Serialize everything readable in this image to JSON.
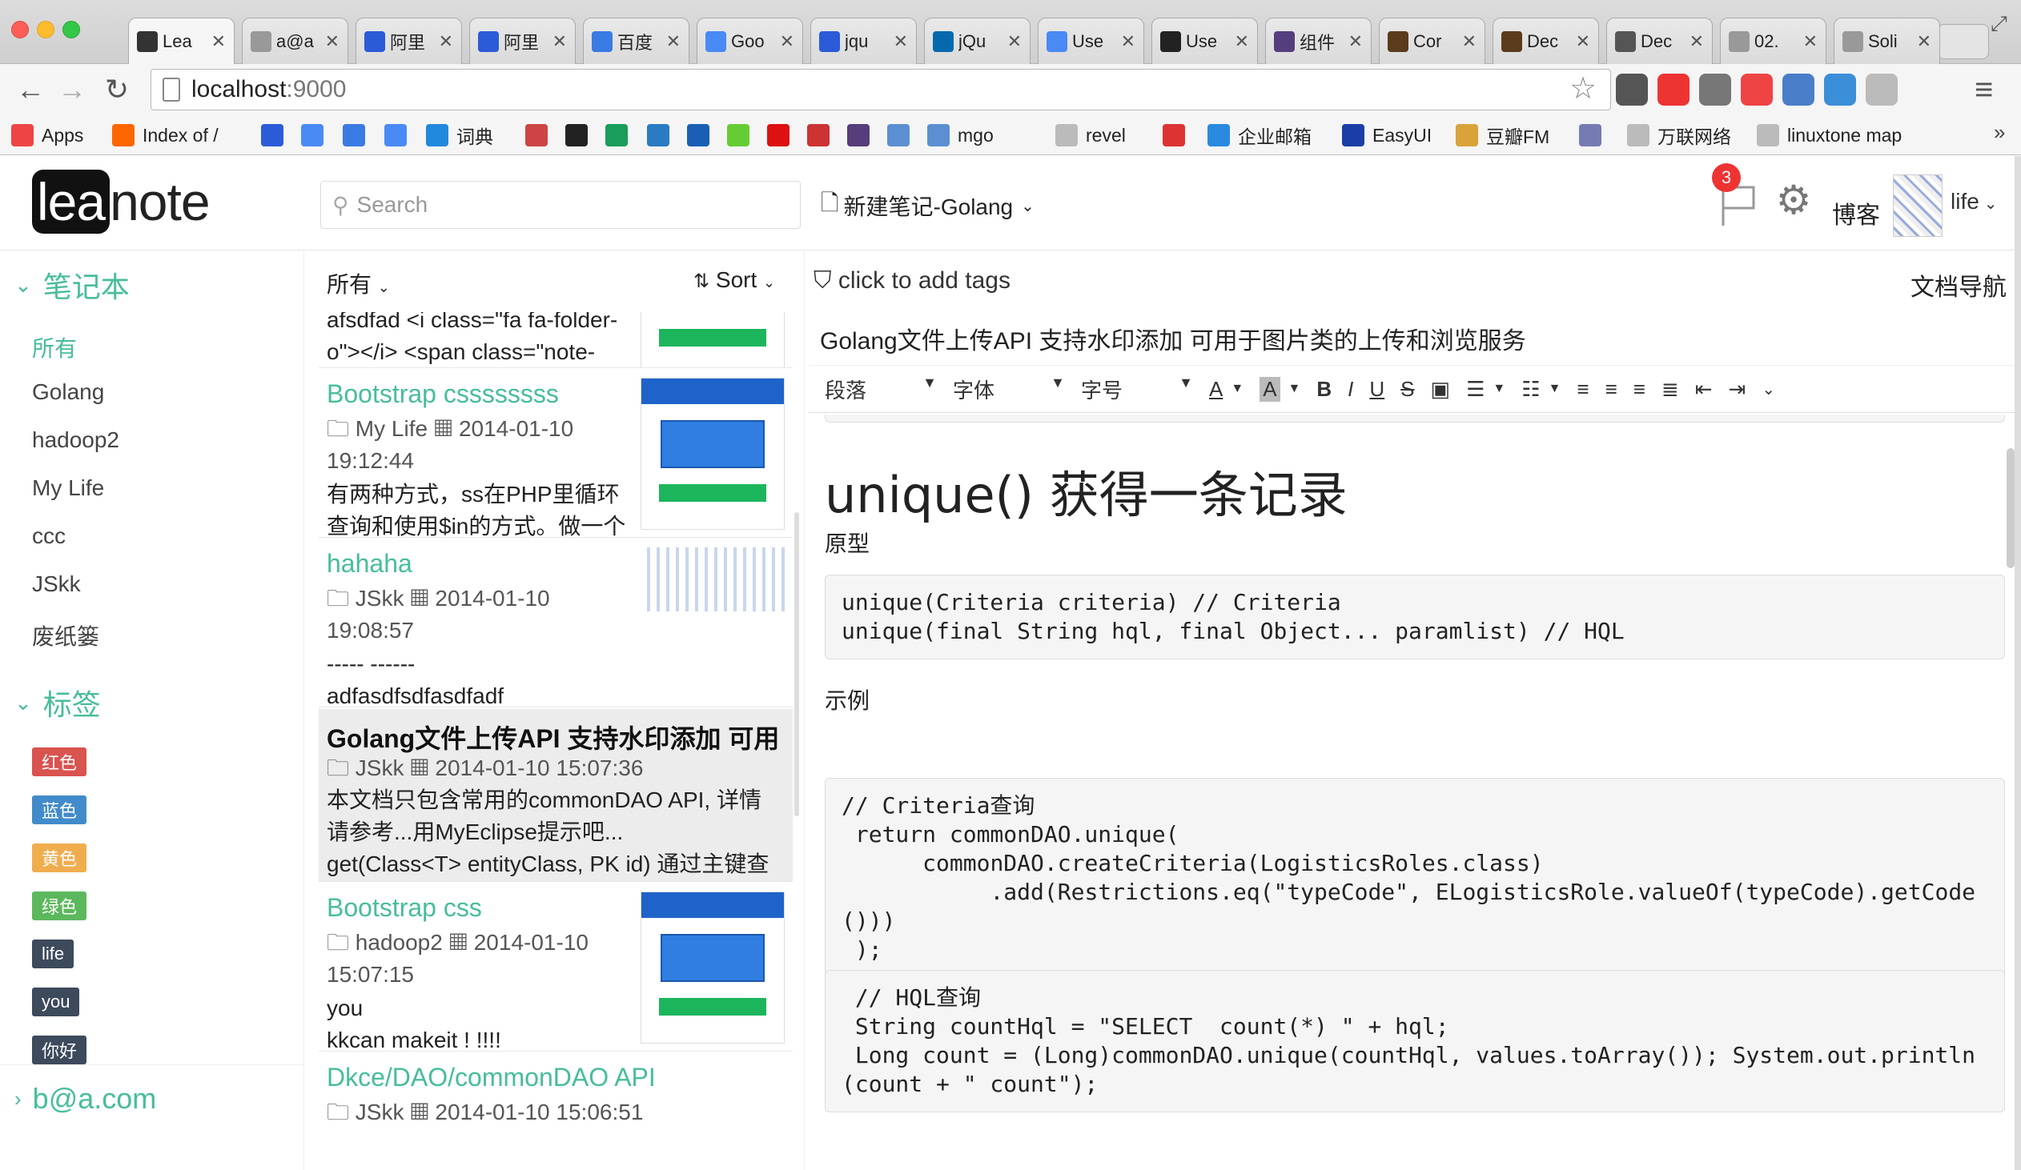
{
  "browser": {
    "tabs": [
      {
        "label": "Lea",
        "favicon": "leanote-icon",
        "color": "#333"
      },
      {
        "label": "a@a",
        "favicon": "page-icon",
        "color": "#999"
      },
      {
        "label": "阿里",
        "favicon": "paw-icon",
        "color": "#2b5bd7"
      },
      {
        "label": "阿里",
        "favicon": "paw-icon",
        "color": "#2b5bd7"
      },
      {
        "label": "百度",
        "favicon": "translate-icon",
        "color": "#3a7be3"
      },
      {
        "label": "Goo",
        "favicon": "translate-icon",
        "color": "#4a8af4"
      },
      {
        "label": "jqu",
        "favicon": "paw-icon",
        "color": "#2b5bd7"
      },
      {
        "label": "jQu",
        "favicon": "jquery-icon",
        "color": "#0769ad"
      },
      {
        "label": "Use",
        "favicon": "google-icon",
        "color": "#4a8af4"
      },
      {
        "label": "Use",
        "favicon": "wikipedia-icon",
        "color": "#222"
      },
      {
        "label": "组件",
        "favicon": "bootstrap-icon",
        "color": "#563d7c"
      },
      {
        "label": "Cor",
        "favicon": "book-icon",
        "color": "#5a3b1c"
      },
      {
        "label": "Dec",
        "favicon": "book-icon",
        "color": "#5a3b1c"
      },
      {
        "label": "Dec",
        "favicon": "bolt-icon",
        "color": "#555"
      },
      {
        "label": "02.",
        "favicon": "page-icon",
        "color": "#999"
      },
      {
        "label": "Soli",
        "favicon": "page-icon",
        "color": "#999"
      }
    ],
    "url_host": "localhost",
    "url_port": ":9000",
    "bookmarks": [
      {
        "label": "Apps",
        "icon": "apps-grid-icon",
        "color": "#e44"
      },
      {
        "label": "Index of /",
        "icon": "folder-icon",
        "color": "#f60"
      },
      {
        "label": "",
        "icon": "paw-icon",
        "color": "#2b5bd7"
      },
      {
        "label": "",
        "icon": "google-icon",
        "color": "#4a8af4"
      },
      {
        "label": "",
        "icon": "chat-icon",
        "color": "#3a7be3"
      },
      {
        "label": "",
        "icon": "translate-icon",
        "color": "#4a8af4"
      },
      {
        "label": "词典",
        "icon": "dict-icon",
        "color": "#2288dd"
      },
      {
        "label": "",
        "icon": "person-icon",
        "color": "#c44"
      },
      {
        "label": "",
        "icon": "github-icon",
        "color": "#222"
      },
      {
        "label": "",
        "icon": "c-icon",
        "color": "#1a9c5a"
      },
      {
        "label": "",
        "icon": "infoq-icon",
        "color": "#2a7bc1"
      },
      {
        "label": "",
        "icon": "kr-icon",
        "color": "#1a5fb4"
      },
      {
        "label": "",
        "icon": "flower-icon",
        "color": "#6c3"
      },
      {
        "label": "",
        "icon": "c-red-icon",
        "color": "#d11"
      },
      {
        "label": "",
        "icon": "w3-icon",
        "color": "#c33"
      },
      {
        "label": "",
        "icon": "bootstrap-icon",
        "color": "#563d7c"
      },
      {
        "label": "",
        "icon": "go-icon",
        "color": "#5b8fd1"
      },
      {
        "label": "mgo",
        "icon": "go-icon",
        "color": "#5b8fd1"
      },
      {
        "label": "revel",
        "icon": "page-icon",
        "color": "#bbb"
      },
      {
        "label": "",
        "icon": "gmail-icon",
        "color": "#d33"
      },
      {
        "label": "企业邮箱",
        "icon": "mail-icon",
        "color": "#2a8ae0"
      },
      {
        "label": "EasyUI",
        "icon": "easyui-icon",
        "color": "#1a3ea6"
      },
      {
        "label": "豆瓣FM",
        "icon": "radio-icon",
        "color": "#d9a33a"
      },
      {
        "label": "",
        "icon": "php-icon",
        "color": "#777bb3"
      },
      {
        "label": "万联网络",
        "icon": "page-icon",
        "color": "#bbb"
      },
      {
        "label": "linuxtone map",
        "icon": "page-icon",
        "color": "#bbb"
      }
    ]
  },
  "header": {
    "search_placeholder": "Search",
    "new_note_label": "新建笔记-Golang",
    "notification_count": "3",
    "blog_label": "博客",
    "username": "life"
  },
  "sidebar": {
    "notebooks_title": "笔记本",
    "notebooks": [
      "所有",
      "Golang",
      "hadoop2",
      "My Life",
      "ccc",
      "JSkk",
      "废纸篓"
    ],
    "active_notebook": "所有",
    "tags_title": "标签",
    "tags": [
      {
        "label": "红色",
        "color": "#d9534f"
      },
      {
        "label": "蓝色",
        "color": "#428bca"
      },
      {
        "label": "黄色",
        "color": "#f0ad4e"
      },
      {
        "label": "绿色",
        "color": "#5cb85c"
      },
      {
        "label": "life",
        "color": "#3c4a5c"
      },
      {
        "label": "you",
        "color": "#3c4a5c"
      },
      {
        "label": "你好",
        "color": "#3c4a5c"
      }
    ],
    "account": "b@a.com"
  },
  "notelist": {
    "filter_label": "所有",
    "sort_label": "Sort",
    "notes": [
      {
        "title": "",
        "notebook": "",
        "date": "",
        "desc": "afsdfad  <i class=\"fa fa-folder-o\"></i> <span class=\"note-"
      },
      {
        "title": "Bootstrap cssssssss",
        "notebook": "My Life",
        "date": "2014-01-10 19:12:44",
        "desc": "有两种方式，ss在PHP里循环查询和使用$in的方式。做一个"
      },
      {
        "title": "hahaha",
        "notebook": "JSkk",
        "date": "2014-01-10 19:08:57",
        "desc": "-----   ------\nadfasdfsdfasdfadf"
      },
      {
        "title": "Golang文件上传API 支持水印添加 可用",
        "notebook": "JSkk",
        "date": "2014-01-10 15:07:36",
        "desc": "本文档只包含常用的commonDAO API, 详情请参考...用MyEclipse提示吧...\nget(Class<T> entityClass, PK id) 通过主键查询"
      },
      {
        "title": "Bootstrap css",
        "notebook": "hadoop2",
        "date": "2014-01-10 15:07:15",
        "desc": "you\nkkcan makeit ! !!!!"
      },
      {
        "title": "Dkce/DAO/commonDAO API",
        "notebook": "JSkk",
        "date": "2014-01-10 15:06:51",
        "desc": ""
      }
    ]
  },
  "editor": {
    "tags_placeholder": "click to add tags",
    "doc_nav_label": "文档导航",
    "title": "Golang文件上传API 支持水印添加 可用于图片类的上传和浏览服务",
    "toolbar": {
      "paragraph": "段落",
      "font": "字体",
      "font_size": "字号"
    },
    "heading": "unique() 获得一条记录",
    "label_prototype": "原型",
    "code1": "unique(Criteria criteria) // Criteria\nunique(final String hql, final Object... paramlist) // HQL",
    "label_example": "示例",
    "code2": "// Criteria查询\n return commonDAO.unique(\n      commonDAO.createCriteria(LogisticsRoles.class)\n           .add(Restrictions.eq(\"typeCode\", ELogisticsRole.valueOf(typeCode).getCode()))\n );",
    "code3": " // HQL查询\n String countHql = \"SELECT  count(*) \" + hql;\n Long count = (Long)commonDAO.unique(countHql, values.toArray()); System.out.println(count + \" count\");"
  },
  "colors": {
    "accent": "#47bd9b"
  }
}
